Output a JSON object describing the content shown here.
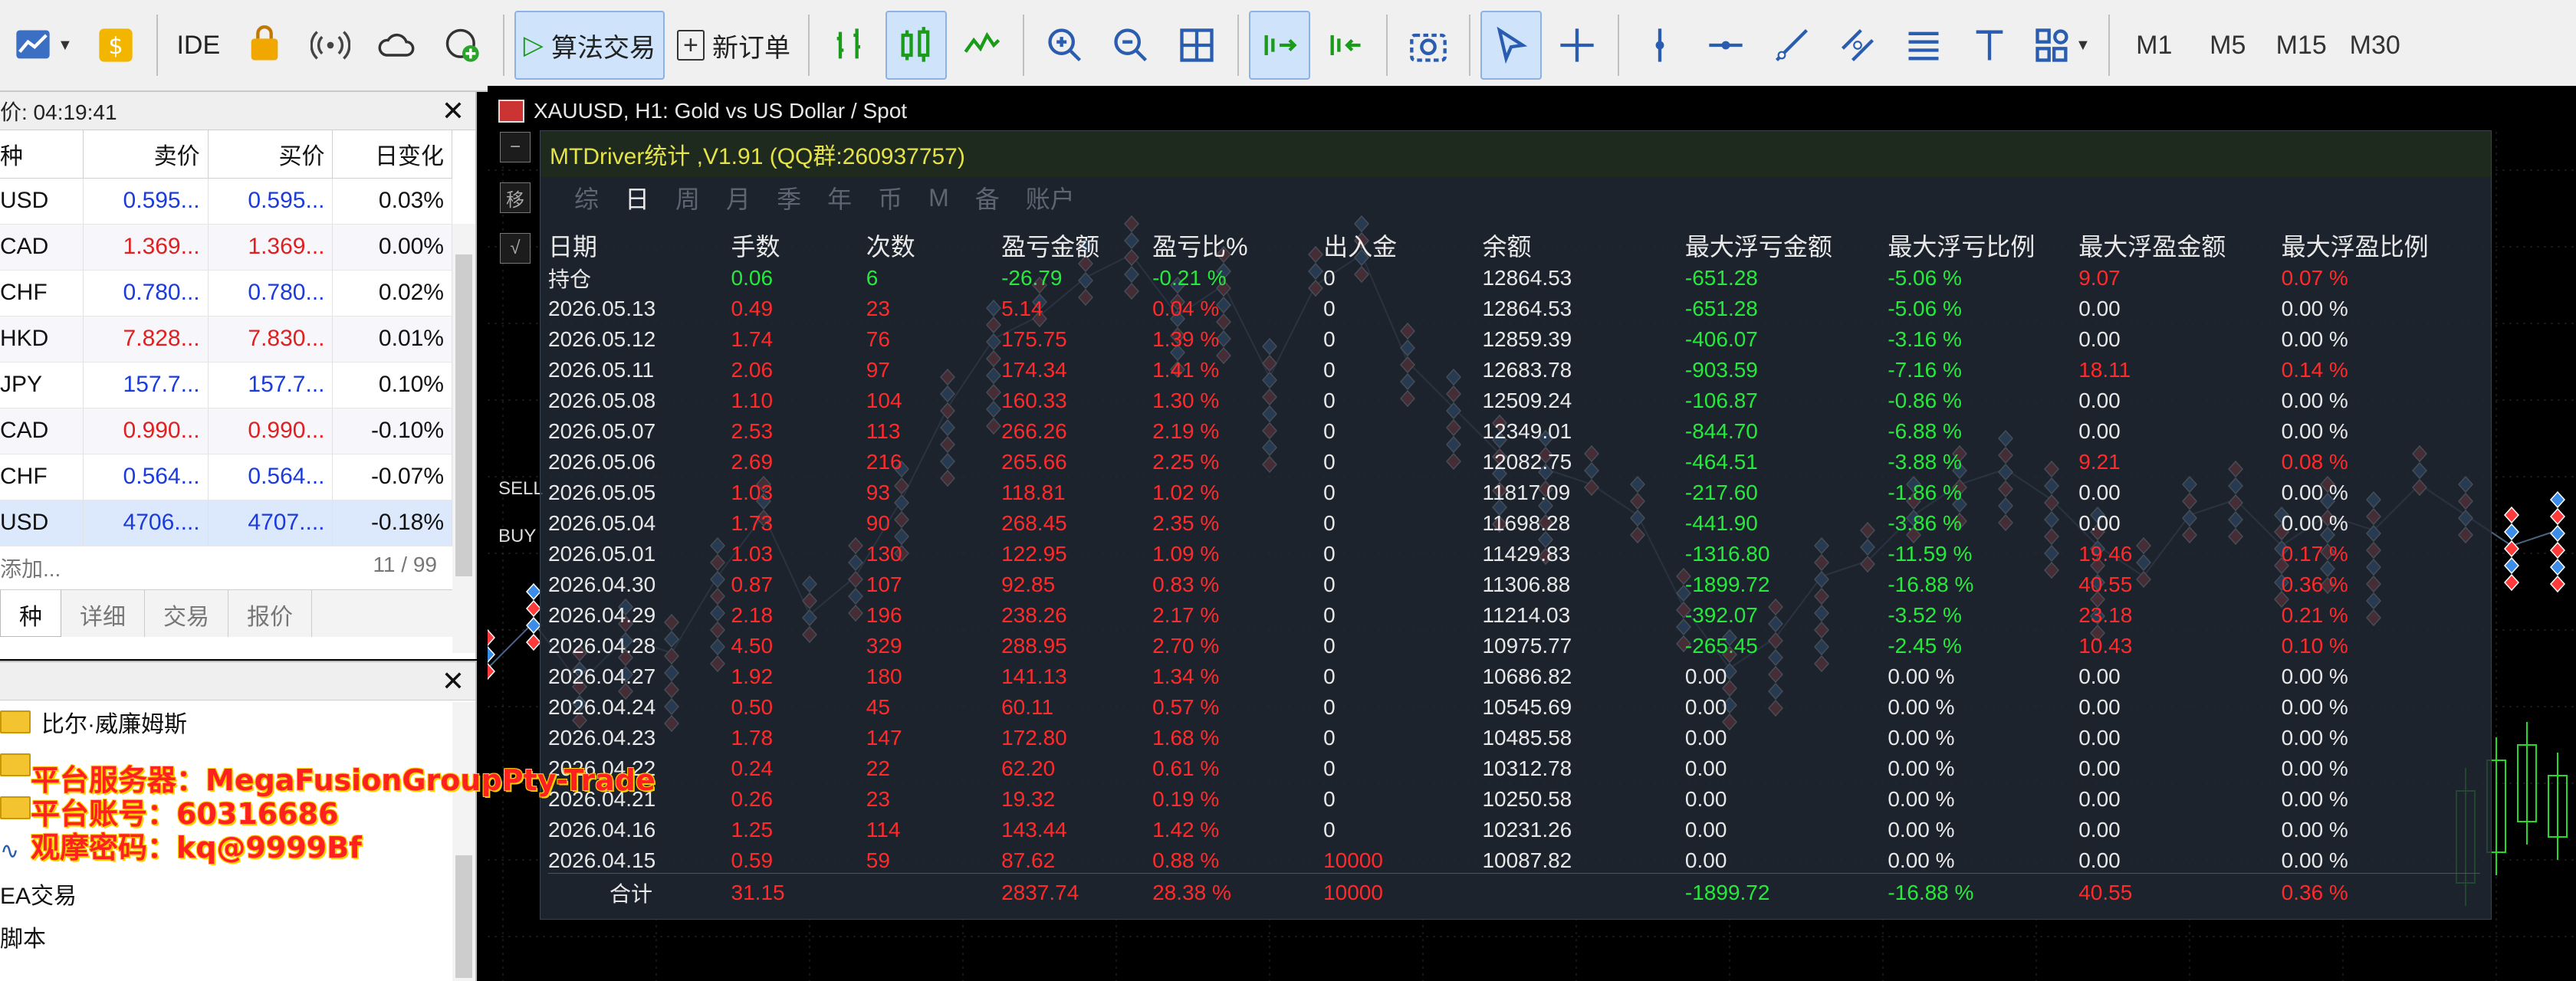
{
  "toolbar": {
    "ide_label": "IDE",
    "algo_label": "算法交易",
    "new_order_label": "新订单",
    "timeframes": [
      "M1",
      "M5",
      "M15",
      "M30"
    ]
  },
  "market_watch": {
    "header_label": "价: 04:19:41",
    "columns": [
      "种",
      "卖价",
      "买价",
      "日变化"
    ],
    "rows": [
      {
        "symbol": "USD",
        "bid": "0.595...",
        "ask": "0.595...",
        "change": "0.03%",
        "bid_dir": "up"
      },
      {
        "symbol": "CAD",
        "bid": "1.369...",
        "ask": "1.369...",
        "change": "0.00%",
        "bid_dir": "down"
      },
      {
        "symbol": "CHF",
        "bid": "0.780...",
        "ask": "0.780...",
        "change": "0.02%",
        "bid_dir": "up"
      },
      {
        "symbol": "HKD",
        "bid": "7.828...",
        "ask": "7.830...",
        "change": "0.01%",
        "bid_dir": "down"
      },
      {
        "symbol": "JPY",
        "bid": "157.7...",
        "ask": "157.7...",
        "change": "0.10%",
        "bid_dir": "up"
      },
      {
        "symbol": "CAD",
        "bid": "0.990...",
        "ask": "0.990...",
        "change": "-0.10%",
        "bid_dir": "down"
      },
      {
        "symbol": "CHF",
        "bid": "0.564...",
        "ask": "0.564...",
        "change": "-0.07%",
        "bid_dir": "up"
      },
      {
        "symbol": "USD",
        "bid": "4706....",
        "ask": "4707....",
        "change": "-0.18%",
        "bid_dir": "up"
      }
    ],
    "add_label": "添加...",
    "count_label": "11 / 99",
    "tabs": [
      "种",
      "详细",
      "交易",
      "报价"
    ]
  },
  "navigator": {
    "items": [
      "比尔·威廉姆斯",
      "EA交易",
      "脚本"
    ]
  },
  "chart": {
    "title": "XAUUSD, H1:  Gold vs US Dollar / Spot",
    "buy_label": "BUY",
    "sell_label": "SELL"
  },
  "stats": {
    "title": "MTDriver统计 ,V1.91 (QQ群:260937757)",
    "tabs": [
      "综",
      "日",
      "周",
      "月",
      "季",
      "年",
      "币",
      "M",
      "备",
      "账户"
    ],
    "active_tab": 1,
    "columns": [
      "日期",
      "手数",
      "次数",
      "盈亏金额",
      "盈亏比%",
      "出入金",
      "余额",
      "最大浮亏金额",
      "最大浮亏比例",
      "最大浮盈金额",
      "最大浮盈比例"
    ],
    "rows": [
      [
        "持仓",
        "0.06",
        "6",
        "-26.79",
        "-0.21 %",
        "0",
        "12864.53",
        "-651.28",
        "-5.06 %",
        "9.07",
        "0.07 %"
      ],
      [
        "2026.05.13",
        "0.49",
        "23",
        "5.14",
        "0.04 %",
        "0",
        "12864.53",
        "-651.28",
        "-5.06 %",
        "0.00",
        "0.00 %"
      ],
      [
        "2026.05.12",
        "1.74",
        "76",
        "175.75",
        "1.39 %",
        "0",
        "12859.39",
        "-406.07",
        "-3.16 %",
        "0.00",
        "0.00 %"
      ],
      [
        "2026.05.11",
        "2.06",
        "97",
        "174.34",
        "1.41 %",
        "0",
        "12683.78",
        "-903.59",
        "-7.16 %",
        "18.11",
        "0.14 %"
      ],
      [
        "2026.05.08",
        "1.10",
        "104",
        "160.33",
        "1.30 %",
        "0",
        "12509.24",
        "-106.87",
        "-0.86 %",
        "0.00",
        "0.00 %"
      ],
      [
        "2026.05.07",
        "2.53",
        "113",
        "266.26",
        "2.19 %",
        "0",
        "12349.01",
        "-844.70",
        "-6.88 %",
        "0.00",
        "0.00 %"
      ],
      [
        "2026.05.06",
        "2.69",
        "216",
        "265.66",
        "2.25 %",
        "0",
        "12082.75",
        "-464.51",
        "-3.88 %",
        "9.21",
        "0.08 %"
      ],
      [
        "2026.05.05",
        "1.03",
        "93",
        "118.81",
        "1.02 %",
        "0",
        "11817.09",
        "-217.60",
        "-1.86 %",
        "0.00",
        "0.00 %"
      ],
      [
        "2026.05.04",
        "1.73",
        "90",
        "268.45",
        "2.35 %",
        "0",
        "11698.28",
        "-441.90",
        "-3.86 %",
        "0.00",
        "0.00 %"
      ],
      [
        "2026.05.01",
        "1.03",
        "130",
        "122.95",
        "1.09 %",
        "0",
        "11429.83",
        "-1316.80",
        "-11.59 %",
        "19.46",
        "0.17 %"
      ],
      [
        "2026.04.30",
        "0.87",
        "107",
        "92.85",
        "0.83 %",
        "0",
        "11306.88",
        "-1899.72",
        "-16.88 %",
        "40.55",
        "0.36 %"
      ],
      [
        "2026.04.29",
        "2.18",
        "196",
        "238.26",
        "2.17 %",
        "0",
        "11214.03",
        "-392.07",
        "-3.52 %",
        "23.18",
        "0.21 %"
      ],
      [
        "2026.04.28",
        "4.50",
        "329",
        "288.95",
        "2.70 %",
        "0",
        "10975.77",
        "-265.45",
        "-2.45 %",
        "10.43",
        "0.10 %"
      ],
      [
        "2026.04.27",
        "1.92",
        "180",
        "141.13",
        "1.34 %",
        "0",
        "10686.82",
        "0.00",
        "0.00 %",
        "0.00",
        "0.00 %"
      ],
      [
        "2026.04.24",
        "0.50",
        "45",
        "60.11",
        "0.57 %",
        "0",
        "10545.69",
        "0.00",
        "0.00 %",
        "0.00",
        "0.00 %"
      ],
      [
        "2026.04.23",
        "1.78",
        "147",
        "172.80",
        "1.68 %",
        "0",
        "10485.58",
        "0.00",
        "0.00 %",
        "0.00",
        "0.00 %"
      ],
      [
        "2026.04.22",
        "0.24",
        "22",
        "62.20",
        "0.61 %",
        "0",
        "10312.78",
        "0.00",
        "0.00 %",
        "0.00",
        "0.00 %"
      ],
      [
        "2026.04.21",
        "0.26",
        "23",
        "19.32",
        "0.19 %",
        "0",
        "10250.58",
        "0.00",
        "0.00 %",
        "0.00",
        "0.00 %"
      ],
      [
        "2026.04.16",
        "1.25",
        "114",
        "143.44",
        "1.42 %",
        "0",
        "10231.26",
        "0.00",
        "0.00 %",
        "0.00",
        "0.00 %"
      ],
      [
        "2026.04.15",
        "0.59",
        "59",
        "87.62",
        "0.88 %",
        "10000",
        "10087.82",
        "0.00",
        "0.00 %",
        "0.00",
        "0.00 %"
      ]
    ],
    "total": [
      "合计",
      "31.15",
      "",
      "2837.74",
      "28.38 %",
      "10000",
      "",
      "-1899.72",
      "-16.88 %",
      "40.55",
      "0.36 %"
    ]
  },
  "overlay": {
    "server": "平台服务器：MegaFusionGroupPty-Trade",
    "account": "平台账号：60316686",
    "password": "观摩密码：kq@9999Bf"
  },
  "colors": {
    "profit_red": "#ff2a2a",
    "loss_green": "#27e83d",
    "title_yellow": "#e6e24a",
    "bid_blue": "#1b3bdc"
  }
}
